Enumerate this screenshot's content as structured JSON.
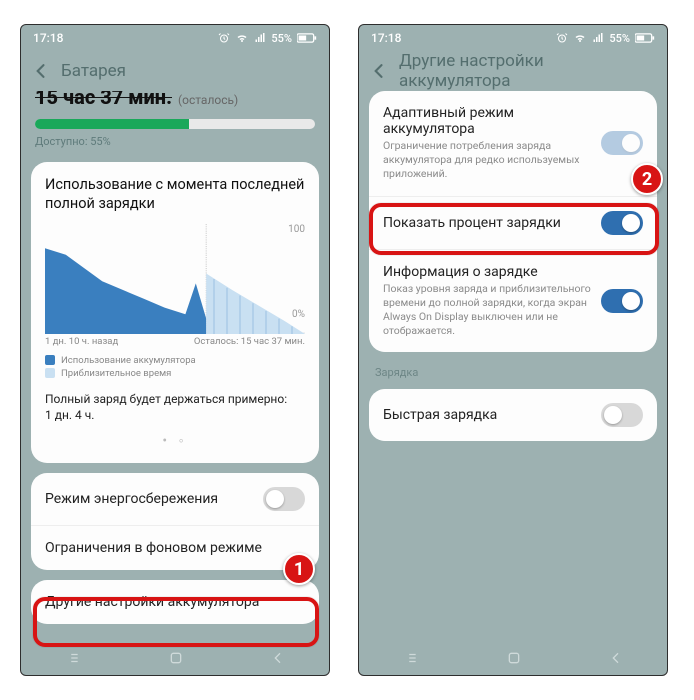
{
  "statusbar": {
    "time": "17:18",
    "battery_text": "55%"
  },
  "left": {
    "header_title": "Батарея",
    "remaining_big": "15 час 37 мин.",
    "remaining_label": "(осталось)",
    "available_pct": 55,
    "available_label": "Доступно: 55%",
    "usage_title": "Использование с момента последней полной зарядки",
    "x_left": "1 дн. 10 ч. назад",
    "x_right": "Осталось: 15 час 37 мин.",
    "legend_used": "Использование аккумулятора",
    "legend_est": "Приблизительное время",
    "full_est_line1": "Полный заряд будет держаться примерно:",
    "full_est_line2": "1 дн. 4 ч.",
    "row_powersave": "Режим энергосбережения",
    "row_bglimit": "Ограничения в фоновом режиме",
    "row_more": "Другие настройки аккумулятора"
  },
  "right": {
    "header_title": "Другие настройки аккумулятора",
    "adaptive_title": "Адаптивный режим аккумулятора",
    "adaptive_sub": "Ограничение потребления заряда аккумулятора для редко используемых приложений.",
    "show_pct": "Показать процент зарядки",
    "charge_info_title": "Информация о зарядке",
    "charge_info_sub": "Показ уровня заряда и приблизительного времени до полной зарядки, когда экран Always On Display выключен или не отображается.",
    "section_charging": "Зарядка",
    "fast_charge": "Быстрая зарядка"
  },
  "chart_data": {
    "type": "area",
    "ylim": [
      0,
      100
    ],
    "x_split_frac": 0.62,
    "series": [
      {
        "name": "used",
        "color": "#3a7fbf",
        "points": [
          [
            0,
            78
          ],
          [
            8,
            72
          ],
          [
            15,
            60
          ],
          [
            22,
            48
          ],
          [
            30,
            40
          ],
          [
            38,
            32
          ],
          [
            46,
            24
          ],
          [
            54,
            18
          ],
          [
            58,
            46
          ],
          [
            62,
            14
          ]
        ]
      },
      {
        "name": "estimate",
        "color": "#c9e0f2",
        "points": [
          [
            62,
            55
          ],
          [
            72,
            40
          ],
          [
            82,
            26
          ],
          [
            92,
            12
          ],
          [
            100,
            0
          ]
        ]
      }
    ]
  },
  "badges": {
    "one": "1",
    "two": "2"
  }
}
